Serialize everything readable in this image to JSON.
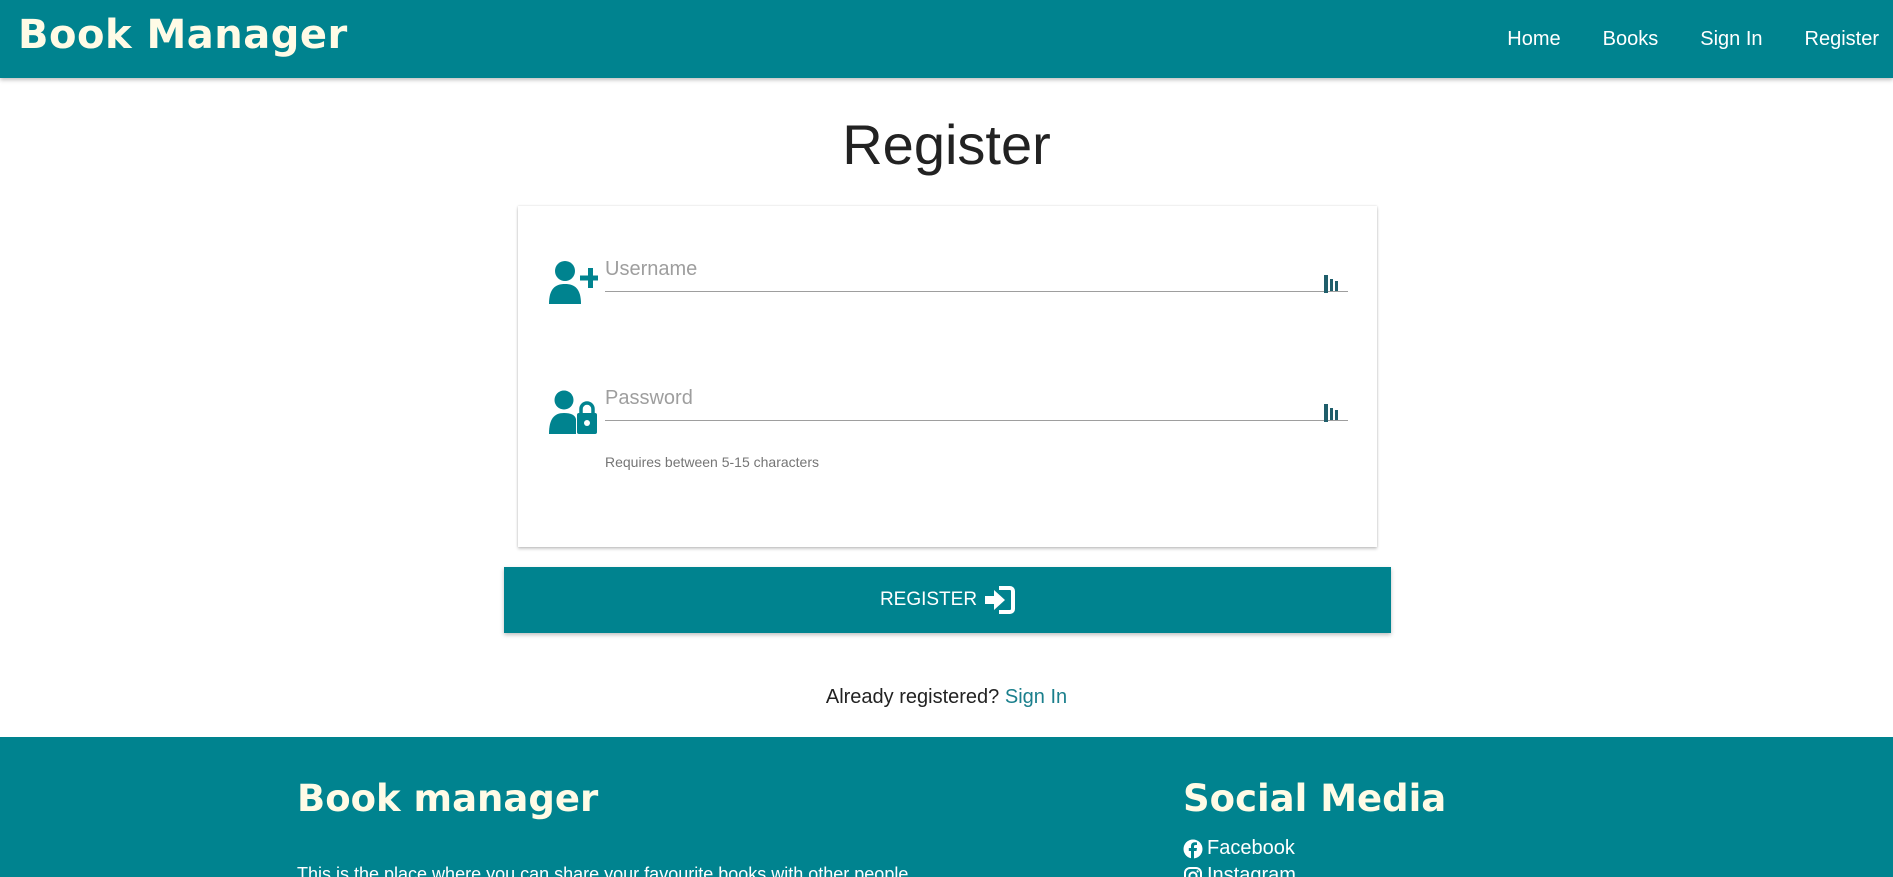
{
  "header": {
    "brand": "Book Manager",
    "nav": [
      "Home",
      "Books",
      "Sign In",
      "Register"
    ]
  },
  "page": {
    "title": "Register"
  },
  "form": {
    "username_placeholder": "Username",
    "password_placeholder": "Password",
    "password_helper": "Requires between 5-15 characters",
    "submit_label": "REGISTER"
  },
  "signin_prompt": {
    "text": "Already registered?",
    "link": "Sign In"
  },
  "footer": {
    "title": "Book manager",
    "text": "This is the place where you can share your favourite books with other people",
    "social_title": "Social Media",
    "social_links": [
      "Facebook",
      "Instagram"
    ]
  },
  "icons": {
    "user-plus": "user-plus-icon",
    "user-lock": "user-lock-icon",
    "field-suffix": "password-manager-icon",
    "submit": "sign-in-icon",
    "facebook": "facebook-icon",
    "instagram": "instagram-icon"
  },
  "colors": {
    "primary": "#00838f",
    "brand_text": "#fffbe6",
    "link": "#1a7f8c"
  }
}
